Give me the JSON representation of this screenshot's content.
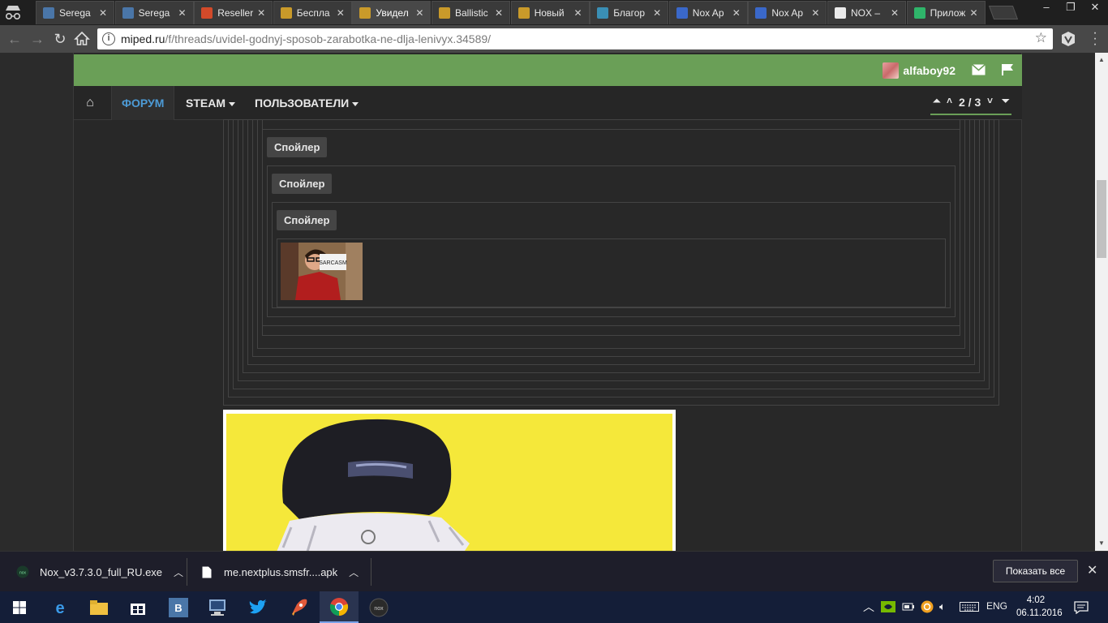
{
  "browser": {
    "tabs": [
      {
        "title": "Serega",
        "icon": "vk-icon",
        "color": "#4a76a8"
      },
      {
        "title": "Serega",
        "icon": "vk-icon",
        "color": "#4a76a8"
      },
      {
        "title": "Reseller",
        "icon": "rocket-icon",
        "color": "#d24a2a"
      },
      {
        "title": "Беспла",
        "icon": "miped-icon",
        "color": "#c99a2a"
      },
      {
        "title": "Увидел",
        "icon": "miped-icon",
        "color": "#c99a2a",
        "active": true
      },
      {
        "title": "Ballistic",
        "icon": "miped-icon",
        "color": "#c99a2a"
      },
      {
        "title": "Новый",
        "icon": "miped-icon",
        "color": "#c99a2a"
      },
      {
        "title": "Благор",
        "icon": "site-icon",
        "color": "#3a8fb5"
      },
      {
        "title": "Nox Ap",
        "icon": "nox-app-icon",
        "color": "#3a68c9"
      },
      {
        "title": "Nox Ap",
        "icon": "nox-app-icon",
        "color": "#3a68c9"
      },
      {
        "title": "NOX –",
        "icon": "nox-icon",
        "color": "#eaeaea"
      },
      {
        "title": "Прилож",
        "icon": "google-play-icon",
        "color": "#2fb56a"
      }
    ],
    "url": {
      "host": "miped.ru",
      "path": "/f/threads/uvidel-godnyj-sposob-zarabotka-ne-dlja-lenivyx.34589/"
    }
  },
  "site": {
    "username": "alfaboy92",
    "nav": {
      "forum": "ФОРУМ",
      "steam": "STEAM",
      "users": "ПОЛЬЗОВАТЕЛИ"
    },
    "pager": "2 / 3",
    "spoiler_label": "Спойлер",
    "thumb_caption": "SARCASM"
  },
  "downloads": [
    {
      "name": "Nox_v3.7.3.0_full_RU.exe"
    },
    {
      "name": "me.nextplus.smsfr....apk"
    }
  ],
  "show_all": "Показать все",
  "taskbar": {
    "lang": "ENG",
    "time": "4:02",
    "date": "06.11.2016"
  }
}
